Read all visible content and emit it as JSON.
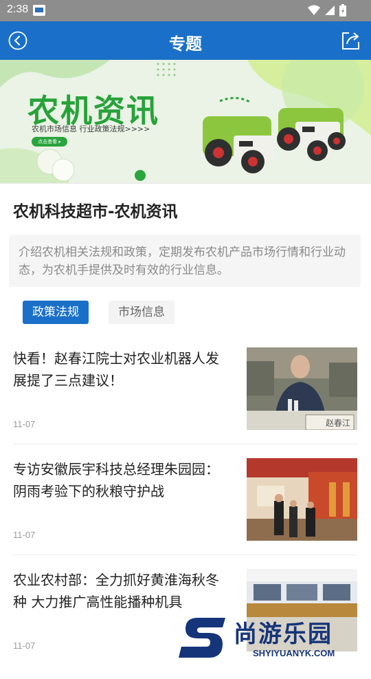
{
  "status_bar": {
    "time": "2:38"
  },
  "app_bar": {
    "title": "专题"
  },
  "banner": {
    "title": "农机资讯",
    "subtitle": "农机市场信息 行业政策法规>>>>",
    "button": "点击查看 ▸"
  },
  "topic": {
    "title": "农机科技超市-农机资讯",
    "intro": "介绍农机相关法规和政策，定期发布农机产品市场行情和行业动态，为农机手提供及时有效的行业信息。"
  },
  "tabs": [
    {
      "label": "政策法规",
      "active": true
    },
    {
      "label": "市场信息",
      "active": false
    }
  ],
  "articles": [
    {
      "title": "快看！赵春江院士对农业机器人发展提了三点建议！",
      "date": "11-07",
      "thumb_caption": "赵春江"
    },
    {
      "title": "专访安徽辰宇科技总经理朱园园：阴雨考验下的秋粮守护战",
      "date": "11-07"
    },
    {
      "title": "农业农村部：全力抓好黄淮海秋冬种 大力推广高性能播种机具",
      "date": "11-07"
    }
  ],
  "watermark": {
    "text": "尚游乐园",
    "url": "SHYIYUANYK.COM"
  },
  "colors": {
    "primary": "#1a70c8",
    "banner_green": "#28a23a",
    "watermark": "#15357a"
  }
}
